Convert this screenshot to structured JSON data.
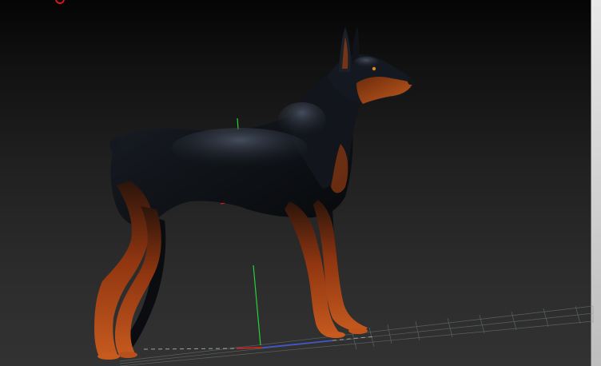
{
  "viewport": {
    "background_top": "#050505",
    "background_bottom": "#323232",
    "scrollbar_color": "#d9d9d9"
  },
  "model": {
    "subject": "doberman",
    "coat_color": "#0f1218",
    "tan_color": "#b9470f",
    "sheen_color": "#5d6678"
  },
  "gizmo": {
    "y_axis_color": "#25d23b",
    "x_axis_color": "#e02525",
    "z_axis_color": "#3b56ff"
  },
  "floor_grid": {
    "line_color": "#7b8a80"
  },
  "marker": {
    "color": "#d21a1a"
  }
}
